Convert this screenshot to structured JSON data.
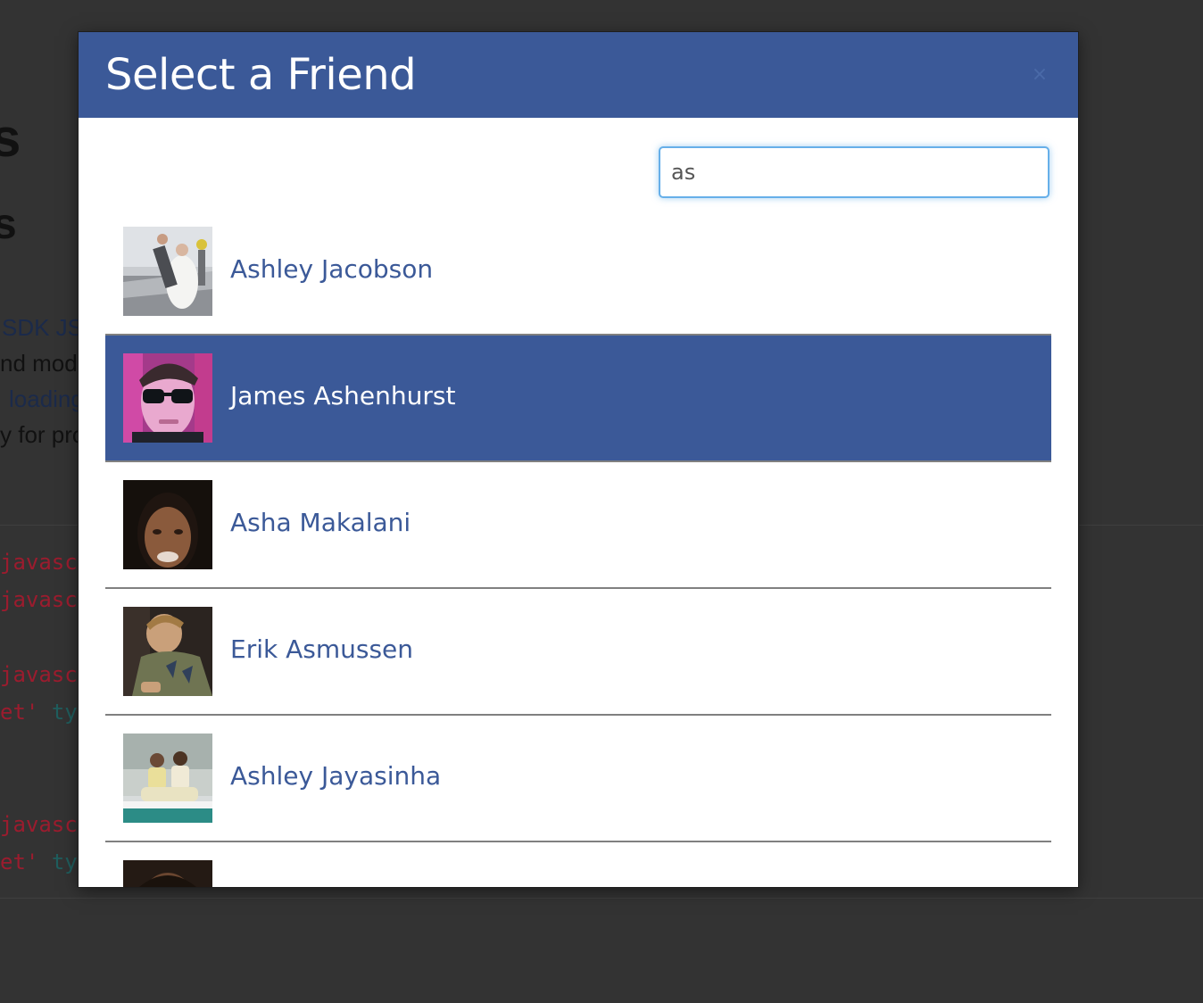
{
  "background": {
    "top_text": "",
    "heading_1": "s",
    "heading_2": "s",
    "para_lines": [
      {
        "prefix": "",
        "link": "SDK JS",
        "text": ""
      },
      {
        "prefix": "",
        "link": "",
        "text": "nd modi"
      },
      {
        "prefix": "",
        "link": "loading",
        "text": ""
      },
      {
        "prefix": "",
        "link": "",
        "text": "y for pro"
      }
    ],
    "code_lines": [
      {
        "red": "javascr",
        "teal": ""
      },
      {
        "red": "javascr",
        "teal": ""
      },
      {
        "red": "javascr",
        "teal": ""
      },
      {
        "red": "et'",
        "teal": "typ"
      },
      {
        "red": "javascr",
        "teal": ""
      },
      {
        "red": "et'",
        "teal": "typ"
      }
    ]
  },
  "modal": {
    "title": "Select a Friend",
    "close_glyph": "×",
    "search": {
      "value": "as",
      "placeholder": ""
    },
    "friends": [
      {
        "name": "Ashley Jacobson",
        "selected": false,
        "avatar": "avatar-wedding-boat"
      },
      {
        "name": "James Ashenhurst",
        "selected": true,
        "avatar": "avatar-sunglasses-pink"
      },
      {
        "name": "Asha Makalani",
        "selected": false,
        "avatar": "avatar-woman-dark"
      },
      {
        "name": "Erik Asmussen",
        "selected": false,
        "avatar": "avatar-man-green-shirt"
      },
      {
        "name": "Ashley Jayasinha",
        "selected": false,
        "avatar": "avatar-couple-beach"
      },
      {
        "name": "",
        "selected": false,
        "avatar": "avatar-partial"
      }
    ]
  },
  "colors": {
    "overlay": "#333333",
    "brand": "#3b5998",
    "link": "#3b5998",
    "focus_ring": "#66afe9",
    "code_red": "#9b1c2e",
    "code_teal": "#1f5e5e"
  }
}
